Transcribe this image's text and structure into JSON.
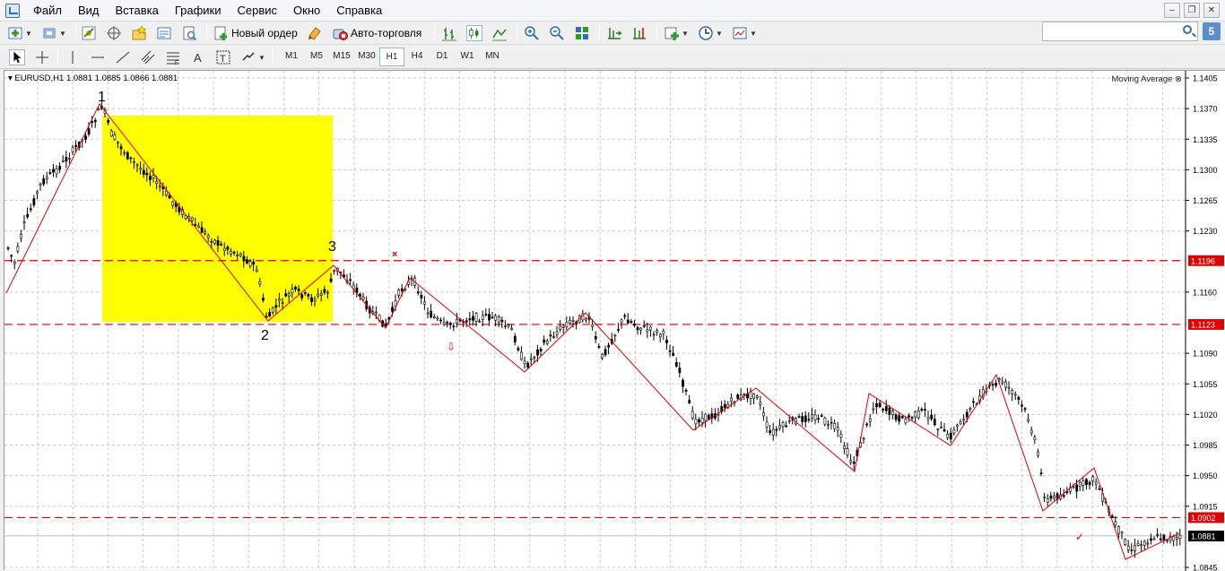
{
  "menu": [
    "Файл",
    "Вид",
    "Вставка",
    "Графики",
    "Сервис",
    "Окно",
    "Справка"
  ],
  "toolbar": {
    "new_order_label": "Новый ордер",
    "auto_trading_label": "Авто-торговля"
  },
  "search": {
    "placeholder": ""
  },
  "notifications_count": "5",
  "timeframes": [
    "M1",
    "M5",
    "M15",
    "M30",
    "H1",
    "H4",
    "D1",
    "W1",
    "MN"
  ],
  "active_timeframe": "H1",
  "chart": {
    "symbol_header": "EURUSD,H1  1.0881 1.0885 1.0866 1.0881",
    "indicator": "Moving Average",
    "point_labels": [
      "1",
      "2",
      "3"
    ],
    "price_ticks": [
      "1.1405",
      "1.1370",
      "1.1335",
      "1.1300",
      "1.1265",
      "1.1230",
      "1.1160",
      "1.1090",
      "1.1055",
      "1.1020",
      "1.0985",
      "1.0950",
      "1.0915",
      "1.0845"
    ],
    "levels": [
      {
        "price": "1.1196",
        "color": "#e00000"
      },
      {
        "price": "1.1123",
        "color": "#e00000"
      },
      {
        "price": "1.0902",
        "color": "#e00000"
      }
    ],
    "current_price": "1.0881",
    "colors": {
      "highlight": "#ffff00",
      "zigzag": "#e00000",
      "candles": "#000000",
      "grid": "#c8c8c8"
    }
  }
}
